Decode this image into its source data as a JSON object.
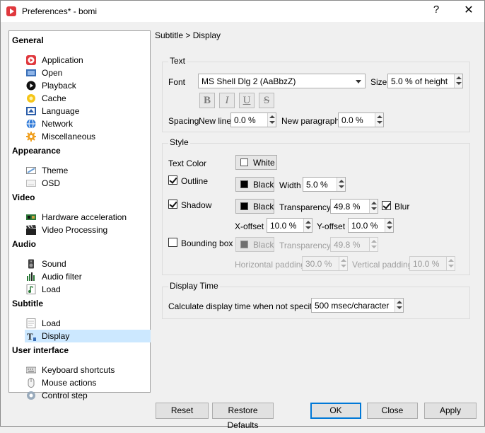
{
  "window": {
    "title": "Preferences* - bomi",
    "help_glyph": "?",
    "close_glyph": "✕"
  },
  "sidebar": {
    "categories": [
      {
        "label": "General",
        "items": [
          {
            "label": "Application",
            "icon": "app-play-icon"
          },
          {
            "label": "Open",
            "icon": "open-folder-icon"
          },
          {
            "label": "Playback",
            "icon": "playback-icon"
          },
          {
            "label": "Cache",
            "icon": "cache-bulb-icon"
          },
          {
            "label": "Language",
            "icon": "language-flag-icon"
          },
          {
            "label": "Network",
            "icon": "network-globe-icon"
          },
          {
            "label": "Miscellaneous",
            "icon": "misc-gear-icon"
          }
        ]
      },
      {
        "label": "Appearance",
        "items": [
          {
            "label": "Theme",
            "icon": "theme-icon"
          },
          {
            "label": "OSD",
            "icon": "osd-icon"
          }
        ]
      },
      {
        "label": "Video",
        "items": [
          {
            "label": "Hardware acceleration",
            "icon": "hardware-card-icon"
          },
          {
            "label": "Video Processing",
            "icon": "video-clapper-icon"
          }
        ]
      },
      {
        "label": "Audio",
        "items": [
          {
            "label": "Sound",
            "icon": "speaker-icon"
          },
          {
            "label": "Audio filter",
            "icon": "audio-filter-icon"
          },
          {
            "label": "Load",
            "icon": "music-note-icon"
          }
        ]
      },
      {
        "label": "Subtitle",
        "items": [
          {
            "label": "Load",
            "icon": "subtitle-load-icon"
          },
          {
            "label": "Display",
            "icon": "subtitle-display-icon",
            "selected": true
          }
        ]
      },
      {
        "label": "User interface",
        "items": [
          {
            "label": "Keyboard shortcuts",
            "icon": "keyboard-icon"
          },
          {
            "label": "Mouse actions",
            "icon": "mouse-icon"
          },
          {
            "label": "Control step",
            "icon": "control-step-icon"
          }
        ]
      }
    ]
  },
  "breadcrumb": "Subtitle > Display",
  "text_group": {
    "title": "Text",
    "font_label": "Font",
    "font_value": "MS Shell Dlg 2 (AaBbzZ)",
    "size_label": "Size",
    "size_value": "5.0 % of height",
    "format_buttons": [
      "B",
      "I",
      "U",
      "S"
    ],
    "spacing_label": "Spacing",
    "newline_label": "New line",
    "newline_value": "0.0 %",
    "newpara_label": "New paragraph",
    "newpara_value": "0.0 %"
  },
  "style_group": {
    "title": "Style",
    "text_color_label": "Text Color",
    "text_color_value": "White",
    "outline_label": "Outline",
    "outline_checked": true,
    "outline_color": "Black",
    "width_label": "Width",
    "width_value": "5.0 %",
    "shadow_label": "Shadow",
    "shadow_checked": true,
    "shadow_color": "Black",
    "transparency_label": "Transparency",
    "shadow_transparency": "49.8 %",
    "blur_label": "Blur",
    "blur_checked": true,
    "xoffset_label": "X-offset",
    "xoffset_value": "10.0 %",
    "yoffset_label": "Y-offset",
    "yoffset_value": "10.0 %",
    "bbox_label": "Bounding box",
    "bbox_checked": false,
    "bbox_color": "Black",
    "bbox_transparency": "49.8 %",
    "hpad_label": "Horizontal padding",
    "hpad_value": "30.0 %",
    "vpad_label": "Vertical padding",
    "vpad_value": "10.0 %"
  },
  "time_group": {
    "title": "Display Time",
    "calc_label": "Calculate display time when not specified",
    "calc_value": "500 msec/character"
  },
  "buttons": {
    "reset": "Reset",
    "restore": "Restore Defaults",
    "ok": "OK",
    "close": "Close",
    "apply": "Apply"
  },
  "colors": {
    "selection": "#cce8ff",
    "default_button_border": "#0078d7",
    "app_icon": "#e0393e"
  }
}
